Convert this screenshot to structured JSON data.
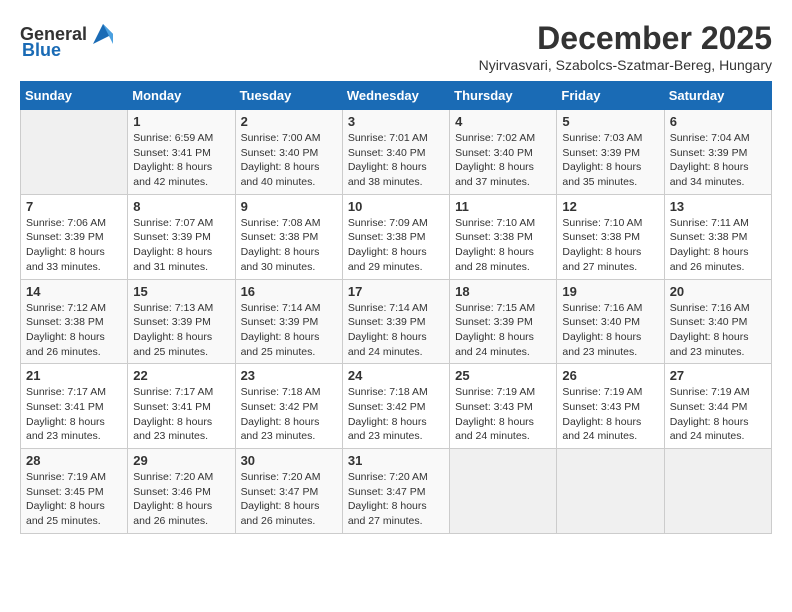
{
  "header": {
    "logo_general": "General",
    "logo_blue": "Blue",
    "month": "December 2025",
    "location": "Nyirvasvari, Szabolcs-Szatmar-Bereg, Hungary"
  },
  "days_of_week": [
    "Sunday",
    "Monday",
    "Tuesday",
    "Wednesday",
    "Thursday",
    "Friday",
    "Saturday"
  ],
  "weeks": [
    [
      {
        "date": "",
        "content": ""
      },
      {
        "date": "1",
        "content": "Sunrise: 6:59 AM\nSunset: 3:41 PM\nDaylight: 8 hours\nand 42 minutes."
      },
      {
        "date": "2",
        "content": "Sunrise: 7:00 AM\nSunset: 3:40 PM\nDaylight: 8 hours\nand 40 minutes."
      },
      {
        "date": "3",
        "content": "Sunrise: 7:01 AM\nSunset: 3:40 PM\nDaylight: 8 hours\nand 38 minutes."
      },
      {
        "date": "4",
        "content": "Sunrise: 7:02 AM\nSunset: 3:40 PM\nDaylight: 8 hours\nand 37 minutes."
      },
      {
        "date": "5",
        "content": "Sunrise: 7:03 AM\nSunset: 3:39 PM\nDaylight: 8 hours\nand 35 minutes."
      },
      {
        "date": "6",
        "content": "Sunrise: 7:04 AM\nSunset: 3:39 PM\nDaylight: 8 hours\nand 34 minutes."
      }
    ],
    [
      {
        "date": "7",
        "content": "Sunrise: 7:06 AM\nSunset: 3:39 PM\nDaylight: 8 hours\nand 33 minutes."
      },
      {
        "date": "8",
        "content": "Sunrise: 7:07 AM\nSunset: 3:39 PM\nDaylight: 8 hours\nand 31 minutes."
      },
      {
        "date": "9",
        "content": "Sunrise: 7:08 AM\nSunset: 3:38 PM\nDaylight: 8 hours\nand 30 minutes."
      },
      {
        "date": "10",
        "content": "Sunrise: 7:09 AM\nSunset: 3:38 PM\nDaylight: 8 hours\nand 29 minutes."
      },
      {
        "date": "11",
        "content": "Sunrise: 7:10 AM\nSunset: 3:38 PM\nDaylight: 8 hours\nand 28 minutes."
      },
      {
        "date": "12",
        "content": "Sunrise: 7:10 AM\nSunset: 3:38 PM\nDaylight: 8 hours\nand 27 minutes."
      },
      {
        "date": "13",
        "content": "Sunrise: 7:11 AM\nSunset: 3:38 PM\nDaylight: 8 hours\nand 26 minutes."
      }
    ],
    [
      {
        "date": "14",
        "content": "Sunrise: 7:12 AM\nSunset: 3:38 PM\nDaylight: 8 hours\nand 26 minutes."
      },
      {
        "date": "15",
        "content": "Sunrise: 7:13 AM\nSunset: 3:39 PM\nDaylight: 8 hours\nand 25 minutes."
      },
      {
        "date": "16",
        "content": "Sunrise: 7:14 AM\nSunset: 3:39 PM\nDaylight: 8 hours\nand 25 minutes."
      },
      {
        "date": "17",
        "content": "Sunrise: 7:14 AM\nSunset: 3:39 PM\nDaylight: 8 hours\nand 24 minutes."
      },
      {
        "date": "18",
        "content": "Sunrise: 7:15 AM\nSunset: 3:39 PM\nDaylight: 8 hours\nand 24 minutes."
      },
      {
        "date": "19",
        "content": "Sunrise: 7:16 AM\nSunset: 3:40 PM\nDaylight: 8 hours\nand 23 minutes."
      },
      {
        "date": "20",
        "content": "Sunrise: 7:16 AM\nSunset: 3:40 PM\nDaylight: 8 hours\nand 23 minutes."
      }
    ],
    [
      {
        "date": "21",
        "content": "Sunrise: 7:17 AM\nSunset: 3:41 PM\nDaylight: 8 hours\nand 23 minutes."
      },
      {
        "date": "22",
        "content": "Sunrise: 7:17 AM\nSunset: 3:41 PM\nDaylight: 8 hours\nand 23 minutes."
      },
      {
        "date": "23",
        "content": "Sunrise: 7:18 AM\nSunset: 3:42 PM\nDaylight: 8 hours\nand 23 minutes."
      },
      {
        "date": "24",
        "content": "Sunrise: 7:18 AM\nSunset: 3:42 PM\nDaylight: 8 hours\nand 23 minutes."
      },
      {
        "date": "25",
        "content": "Sunrise: 7:19 AM\nSunset: 3:43 PM\nDaylight: 8 hours\nand 24 minutes."
      },
      {
        "date": "26",
        "content": "Sunrise: 7:19 AM\nSunset: 3:43 PM\nDaylight: 8 hours\nand 24 minutes."
      },
      {
        "date": "27",
        "content": "Sunrise: 7:19 AM\nSunset: 3:44 PM\nDaylight: 8 hours\nand 24 minutes."
      }
    ],
    [
      {
        "date": "28",
        "content": "Sunrise: 7:19 AM\nSunset: 3:45 PM\nDaylight: 8 hours\nand 25 minutes."
      },
      {
        "date": "29",
        "content": "Sunrise: 7:20 AM\nSunset: 3:46 PM\nDaylight: 8 hours\nand 26 minutes."
      },
      {
        "date": "30",
        "content": "Sunrise: 7:20 AM\nSunset: 3:47 PM\nDaylight: 8 hours\nand 26 minutes."
      },
      {
        "date": "31",
        "content": "Sunrise: 7:20 AM\nSunset: 3:47 PM\nDaylight: 8 hours\nand 27 minutes."
      },
      {
        "date": "",
        "content": ""
      },
      {
        "date": "",
        "content": ""
      },
      {
        "date": "",
        "content": ""
      }
    ]
  ]
}
